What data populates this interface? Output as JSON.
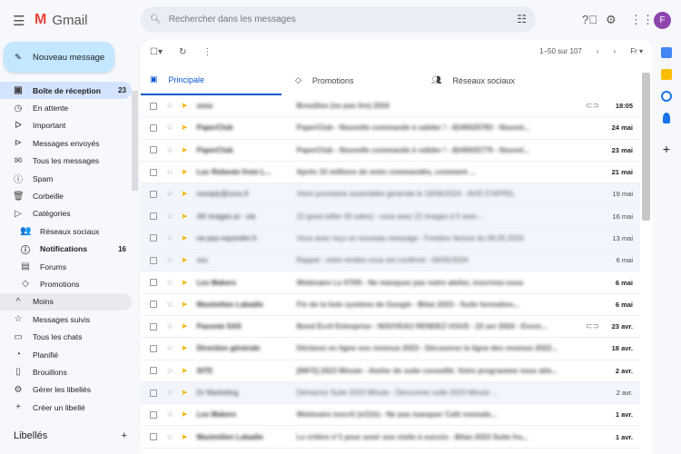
{
  "header": {
    "app_name": "Gmail",
    "search_placeholder": "Rechercher dans les messages",
    "avatar_letter": "F"
  },
  "compose_label": "Nouveau message",
  "sidebar": {
    "items": [
      {
        "label": "Boîte de réception",
        "count": "23",
        "icon": "inbox-icon",
        "glyph": "▣"
      },
      {
        "label": "En attente",
        "icon": "clock-icon",
        "glyph": "◷"
      },
      {
        "label": "Important",
        "icon": "important-icon",
        "glyph": "ᐅ"
      },
      {
        "label": "Messages envoyés",
        "icon": "send-icon",
        "glyph": "⊳"
      },
      {
        "label": "Tous les messages",
        "icon": "all-mail-icon",
        "glyph": "✉"
      },
      {
        "label": "Spam",
        "icon": "spam-icon",
        "glyph": "ⓘ"
      },
      {
        "label": "Corbeille",
        "icon": "trash-icon",
        "glyph": "🗑"
      },
      {
        "label": "Catégories",
        "icon": "label-icon",
        "glyph": "▷"
      },
      {
        "label": "Réseaux sociaux",
        "icon": "people-icon",
        "glyph": "👥"
      },
      {
        "label": "Notifications",
        "count": "16",
        "icon": "info-icon",
        "glyph": "ⓘ"
      },
      {
        "label": "Forums",
        "icon": "forum-icon",
        "glyph": "▤"
      },
      {
        "label": "Promotions",
        "icon": "tag-icon",
        "glyph": "◇"
      },
      {
        "label": "Moins",
        "icon": "chevron-up-icon",
        "glyph": "^"
      },
      {
        "label": "Messages suivis",
        "icon": "star-icon",
        "glyph": "☆"
      },
      {
        "label": "Tous les chats",
        "icon": "chat-icon",
        "glyph": "▭"
      },
      {
        "label": "Planifié",
        "icon": "scheduled-icon",
        "glyph": "◔"
      },
      {
        "label": "Brouillons",
        "icon": "draft-icon",
        "glyph": "▯"
      },
      {
        "label": "Gérer les libellés",
        "icon": "gear-icon",
        "glyph": "⚙"
      },
      {
        "label": "Créer un libellé",
        "icon": "plus-icon",
        "glyph": "+"
      }
    ],
    "labels_heading": "Libellés"
  },
  "pager": {
    "range": "1–50 sur 107",
    "lang": "Fr"
  },
  "tabs": [
    {
      "label": "Principale"
    },
    {
      "label": "Promotions"
    },
    {
      "label": "Réseaux sociaux"
    }
  ],
  "emails": [
    {
      "sender": "xxxx",
      "subject": "Brouillon (ne pas lire) 2024",
      "date": "18:05",
      "unread": true,
      "attach": true
    },
    {
      "sender": "PaperClub",
      "subject": "PaperClub - Nouvelle commande à valider ! - 8240025783 - Nouvel...",
      "date": "24 mai",
      "unread": true
    },
    {
      "sender": "PaperClub",
      "subject": "PaperClub - Nouvelle commande à valider ! - 8240025779 - Nouvel...",
      "date": "23 mai",
      "unread": true
    },
    {
      "sender": "Luc Robesin from L...",
      "subject": "Après 10 millions de mots commandés, comment ...",
      "date": "21 mai",
      "unread": true
    },
    {
      "sender": "noreply@xxxx.fr",
      "subject": "Votre prochaine assemblée générale le 19/06/2024 - AVIS D'APPEL",
      "date": "19 mai",
      "unread": false
    },
    {
      "sender": "AK images.ai - via",
      "subject": "22 good (after 30 sales) - vous avez 22 images à 5 avec...",
      "date": "16 mai",
      "unread": false
    },
    {
      "sender": "ne-pas-repondre.fr",
      "subject": "Vous avez reçu un nouveau message - Freebox facture du 06.05.2024",
      "date": "13 mai",
      "unread": false
    },
    {
      "sender": "xxx",
      "subject": "Rappel : votre rendez-vous est confirmé - 06/05/2024",
      "date": "6 mai",
      "unread": false
    },
    {
      "sender": "Les Makers",
      "subject": "Webinaire Le 07/05 - Ne manquez pas notre atelier, inscrivez-vous",
      "date": "6 mai",
      "unread": true
    },
    {
      "sender": "Maximilien Labadie",
      "subject": "Fin de la liste système de Google - Bilan 2023 - Suite formation...",
      "date": "6 mai",
      "unread": true
    },
    {
      "sender": "Paxonie SAS",
      "subject": "Bond Écrit Entreprise - NOUVEAU RENDEZ-VOUS - 23 avr 2024 - Envoi...",
      "date": "23 avr.",
      "unread": true,
      "attach": true
    },
    {
      "sender": "Direction générale",
      "subject": "Déclarez en ligne vos revenus 2023 - Découvrez la ligne des revenus 2022...",
      "date": "18 avr.",
      "unread": true
    },
    {
      "sender": "SITE",
      "subject": "[INFO] 2023 Minute - Atelier de suite conseillé. Votre programme vous atte...",
      "date": "2 avr.",
      "unread": true
    },
    {
      "sender": "Dr Marketing",
      "subject": "Démarrez Suite 2023 Minute - Découvrez suite 2023 Minute ...",
      "date": "2 avr.",
      "unread": false
    },
    {
      "sender": "Les Makers",
      "subject": "Webinaire inscrit (s/11h) - Ne pas manquer Café nomade...",
      "date": "1 avr.",
      "unread": true
    },
    {
      "sender": "Maximilien Labadie",
      "subject": "Le critère n°1 pour avoir une visite à succès - Bilan 2023 Suite fra...",
      "date": "1 avr.",
      "unread": true
    }
  ]
}
